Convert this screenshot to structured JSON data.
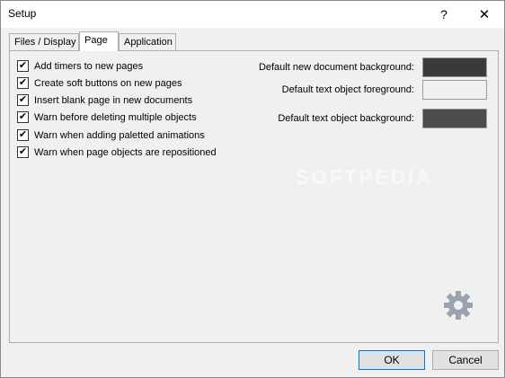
{
  "window": {
    "title": "Setup",
    "help_glyph": "?",
    "close_glyph": "✕"
  },
  "tabs": [
    {
      "label": "Files / Display",
      "active": false
    },
    {
      "label": "Page",
      "active": true
    },
    {
      "label": "Application",
      "active": false
    }
  ],
  "options": [
    {
      "label": "Add timers to new pages",
      "checked": true
    },
    {
      "label": "Create soft buttons on new pages",
      "checked": true
    },
    {
      "label": "Insert blank page in new documents",
      "checked": true
    },
    {
      "label": "Warn before deleting multiple objects",
      "checked": true
    },
    {
      "label": "Warn when adding paletted animations",
      "checked": true
    },
    {
      "label": "Warn when page objects are repositioned",
      "checked": true
    }
  ],
  "colors": [
    {
      "label": "Default new document background:",
      "color": "#3a3a3a"
    },
    {
      "label": "Default text object foreground:",
      "color": "#f0f0f0"
    },
    {
      "label": "Default text object background:",
      "color": "#4d4d4d"
    }
  ],
  "watermark": "SOFTPEDIA",
  "footer": {
    "ok_label": "OK",
    "cancel_label": "Cancel"
  },
  "check_glyph": "✔",
  "icons": {
    "settings": "gear-icon"
  }
}
